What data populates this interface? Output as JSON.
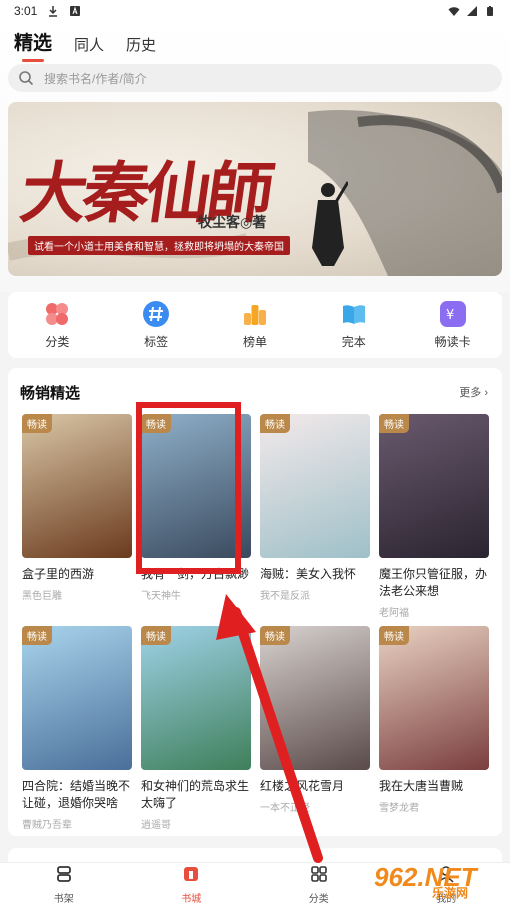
{
  "status": {
    "time": "3:01"
  },
  "tabs": [
    {
      "label": "精选",
      "active": true
    },
    {
      "label": "同人",
      "active": false
    },
    {
      "label": "历史",
      "active": false
    }
  ],
  "search": {
    "placeholder": "搜索书名/作者/简介"
  },
  "banner": {
    "title": "大秦仙師",
    "author": "牧尘客◎著",
    "tagline": "试看一个小道士用美食和智慧，拯救即将坍塌的大秦帝国"
  },
  "quick_links": [
    {
      "label": "分类",
      "icon": "category-icon",
      "color": "#f06a6a"
    },
    {
      "label": "标签",
      "icon": "tag-icon",
      "color": "#3b8cf0"
    },
    {
      "label": "榜单",
      "icon": "ranking-icon",
      "color": "#f5a623"
    },
    {
      "label": "完本",
      "icon": "finished-book-icon",
      "color": "#3aa8e8"
    },
    {
      "label": "畅读卡",
      "icon": "reading-card-icon",
      "color": "#8a6df0"
    }
  ],
  "section": {
    "title": "畅销精选",
    "more": "更多"
  },
  "badge_text": "畅读",
  "books": [
    {
      "name": "盒子里的西游",
      "author": "黑色巨雕",
      "c1": "#d9c7a6",
      "c2": "#6b3a1e"
    },
    {
      "name": "我有一剑，万古飘渺",
      "author": "飞天神牛",
      "c1": "#8fb0c9",
      "c2": "#3a4a5e"
    },
    {
      "name": "海贼：美女入我怀",
      "author": "我不是反派",
      "c1": "#f3e9ea",
      "c2": "#9ec0c8"
    },
    {
      "name": "魔王你只管征服，办法老公来想",
      "author": "老阿福",
      "c1": "#6a5a6e",
      "c2": "#2a2430"
    },
    {
      "name": "四合院：结婚当晚不让碰，退婚你哭啥",
      "author": "曹贼乃吾辈",
      "c1": "#a9d4ec",
      "c2": "#4a6f9a"
    },
    {
      "name": "和女神们的荒岛求生太嗨了",
      "author": "逍遥哥",
      "c1": "#9fd2e8",
      "c2": "#3f7f5a"
    },
    {
      "name": "红楼之风花雪月",
      "author": "一本不正经",
      "c1": "#d8d2cf",
      "c2": "#5a4a4a"
    },
    {
      "name": "我在大唐当曹贼",
      "author": "雪梦龙君",
      "c1": "#e9d2c2",
      "c2": "#7a3e3e"
    }
  ],
  "bottom_nav": [
    {
      "label": "书架",
      "icon": "bookshelf-icon",
      "active": false
    },
    {
      "label": "书城",
      "icon": "bookstore-icon",
      "active": true
    },
    {
      "label": "分类",
      "icon": "category-grid-icon",
      "active": false
    },
    {
      "label": "我的",
      "icon": "profile-icon",
      "active": false
    }
  ],
  "watermark": {
    "logo": "962.NET",
    "sub": "乐游网"
  }
}
